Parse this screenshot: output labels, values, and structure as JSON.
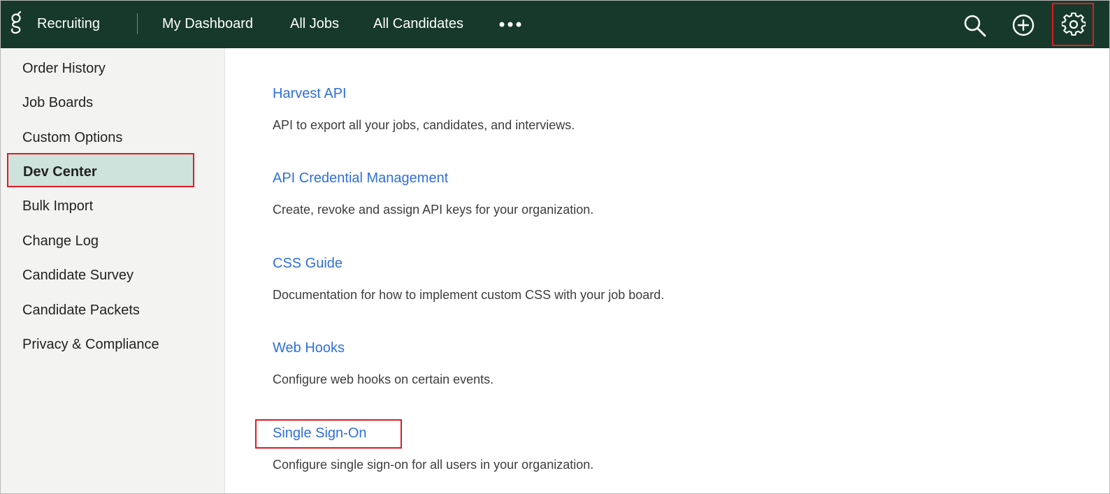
{
  "header": {
    "logo_icon": "greenhouse-g-logo-icon",
    "app_name": "Recruiting",
    "nav": [
      {
        "label": "My Dashboard"
      },
      {
        "label": "All Jobs"
      },
      {
        "label": "All Candidates"
      }
    ],
    "more_icon": "more-dots-icon",
    "actions": [
      {
        "icon": "search-icon"
      },
      {
        "icon": "add-circle-icon"
      },
      {
        "icon": "gear-icon"
      }
    ],
    "background_color": "#17392c"
  },
  "sidebar": {
    "items": [
      {
        "label": "Order History"
      },
      {
        "label": "Job Boards"
      },
      {
        "label": "Custom Options"
      },
      {
        "label": "Dev Center",
        "active": true
      },
      {
        "label": "Bulk Import"
      },
      {
        "label": "Change Log"
      },
      {
        "label": "Candidate Survey"
      },
      {
        "label": "Candidate Packets"
      },
      {
        "label": "Privacy & Compliance"
      }
    ],
    "active_color": "#cde3db"
  },
  "main": {
    "entries": [
      {
        "title": "Harvest API",
        "description": "API to export all your jobs, candidates, and interviews."
      },
      {
        "title": "API Credential Management",
        "description": "Create, revoke and assign API keys for your organization."
      },
      {
        "title": "CSS Guide",
        "description": "Documentation for how to implement custom CSS with your job board."
      },
      {
        "title": "Web Hooks",
        "description": "Configure web hooks on certain events."
      },
      {
        "title": "Single Sign-On",
        "description": "Configure single sign-on for all users in your organization."
      }
    ],
    "link_color": "#2f6fdb"
  },
  "highlight_color": "#e01b24"
}
